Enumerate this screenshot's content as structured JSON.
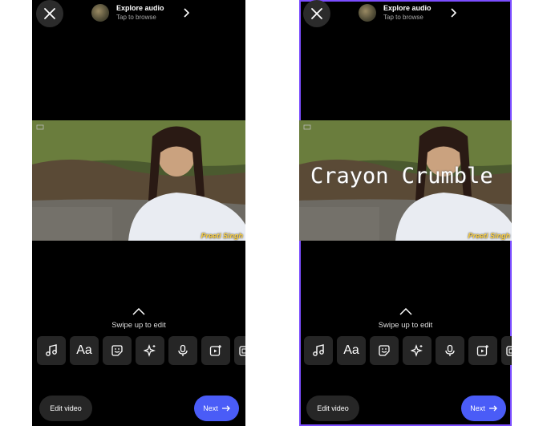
{
  "audio": {
    "title": "Explore audio",
    "subtitle": "Tap to browse"
  },
  "overlay_text": "Crayon Crumble",
  "watermark": "Preeti Singh",
  "swipe": {
    "label": "Swipe up to edit"
  },
  "tools": [
    "music-note-icon",
    "text-tool",
    "sticker-icon",
    "effects-sparkle-icon",
    "microphone-icon",
    "clip-add-icon",
    "overlay-icon"
  ],
  "tool_text_label": "Aa",
  "buttons": {
    "edit_video": "Edit video",
    "next": "Next"
  },
  "colors": {
    "accent": "#4a5cf7",
    "selection_border": "#7b4dff",
    "chip_bg": "#262626",
    "screen_bg": "#000000"
  }
}
